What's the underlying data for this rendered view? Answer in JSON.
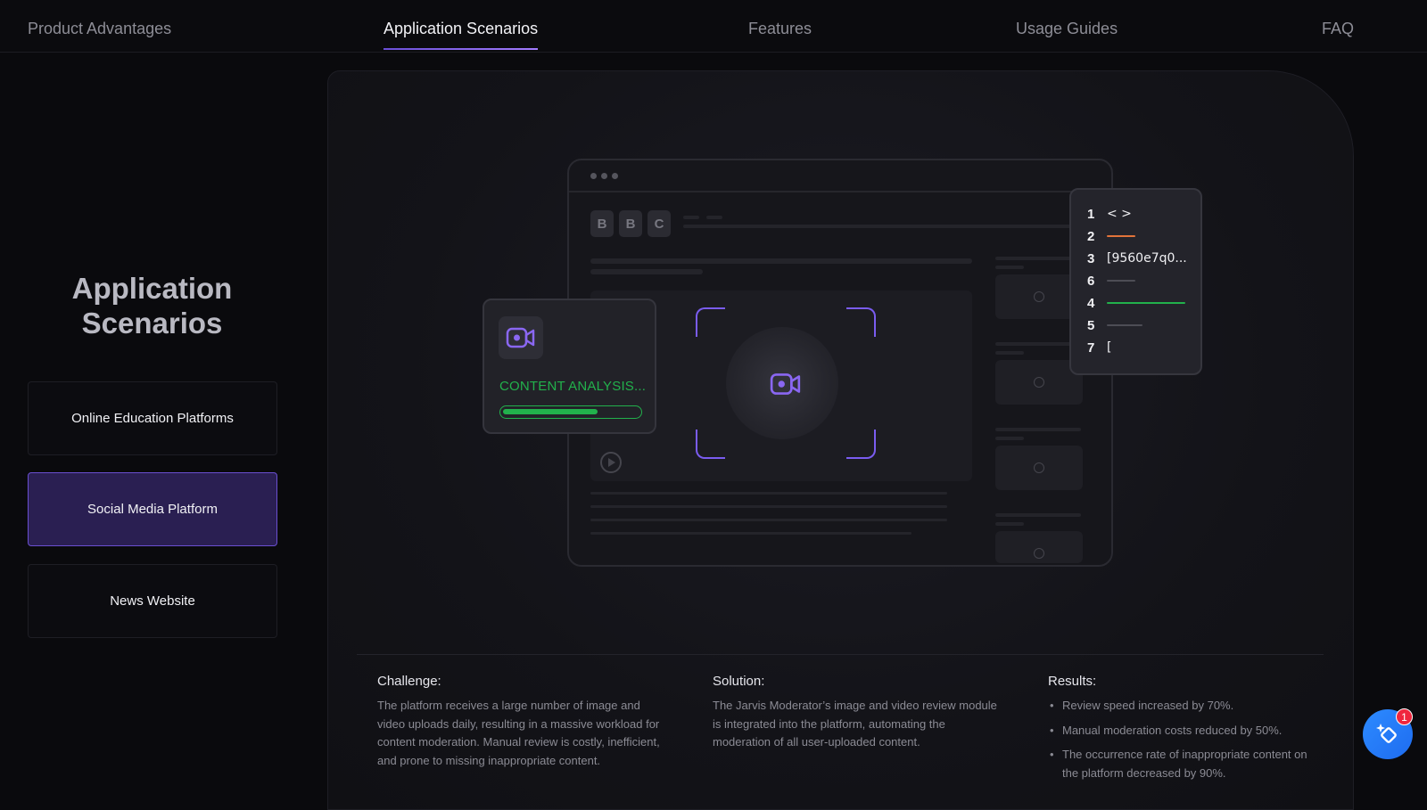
{
  "nav": {
    "tabs": [
      {
        "label": "Product Advantages"
      },
      {
        "label": "Application Scenarios",
        "active": true
      },
      {
        "label": "Features"
      },
      {
        "label": "Usage Guides"
      },
      {
        "label": "FAQ"
      }
    ]
  },
  "sidebar": {
    "title": "Application Scenarios",
    "scenarios": [
      {
        "label": "Online Education Platforms"
      },
      {
        "label": "Social Media Platform",
        "active": true
      },
      {
        "label": "News Website"
      }
    ]
  },
  "illustration": {
    "format_buttons": [
      "B",
      "B",
      "C"
    ],
    "analysis": {
      "label": "CONTENT ANALYSIS...",
      "progress": 0.7,
      "color": "#22b14c"
    },
    "code_lines": [
      {
        "num": "1",
        "text": "< >"
      },
      {
        "num": "2",
        "stroke_color": "#e2733a"
      },
      {
        "num": "3",
        "text": "[9560e7q0..."
      },
      {
        "num": "6",
        "stroke_color": "#4d4d55"
      },
      {
        "num": "4",
        "stroke_color": "#22b14c"
      },
      {
        "num": "5",
        "stroke_color": "#4d4d55"
      },
      {
        "num": "7",
        "text": "["
      }
    ]
  },
  "details": {
    "challenge": {
      "heading": "Challenge:",
      "body": "The platform receives a large number of image and video uploads daily, resulting in a massive workload for content moderation. Manual review is costly, inefficient, and prone to missing inappropriate content."
    },
    "solution": {
      "heading": "Solution:",
      "body": "The Jarvis Moderator’s image and video review module is integrated into the platform, automating the moderation of all user-uploaded content."
    },
    "results": {
      "heading": "Results:",
      "items": [
        "Review speed increased by 70%.",
        "Manual moderation costs reduced by 50%.",
        "The occurrence rate of inappropriate content on the platform decreased by 90%."
      ]
    }
  },
  "assistant": {
    "badge_count": "1",
    "icon": "sparkle-diamond-icon"
  },
  "colors": {
    "accent": "#7a5cf0",
    "active_bg": "#2a1f52",
    "success": "#22b14c",
    "fab": "#1e6cf0"
  }
}
